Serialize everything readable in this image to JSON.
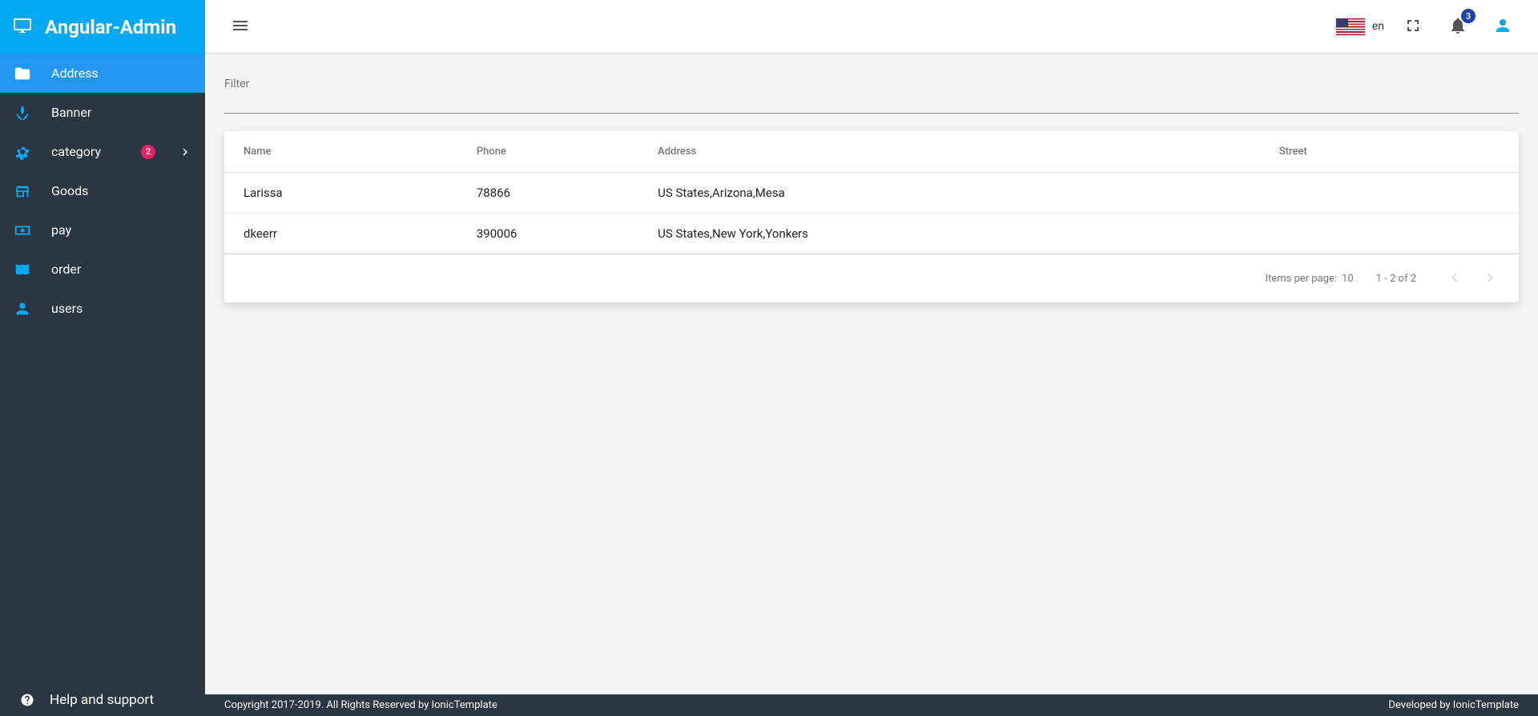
{
  "brand": {
    "title": "Angular-Admin"
  },
  "sidebar": {
    "items": [
      {
        "id": "address",
        "label": "Address",
        "icon": "folder",
        "active": true
      },
      {
        "id": "banner",
        "label": "Banner",
        "icon": "spa"
      },
      {
        "id": "category",
        "label": "category",
        "icon": "settings",
        "badge": "2",
        "expandable": true
      },
      {
        "id": "goods",
        "label": "Goods",
        "icon": "store"
      },
      {
        "id": "pay",
        "label": "pay",
        "icon": "money"
      },
      {
        "id": "order",
        "label": "order",
        "icon": "book"
      },
      {
        "id": "users",
        "label": "users",
        "icon": "person"
      }
    ],
    "footer": {
      "label": "Help and support"
    }
  },
  "topbar": {
    "language_code": "en",
    "notification_count": "3"
  },
  "filter": {
    "label": "Filter",
    "value": ""
  },
  "table": {
    "columns": [
      {
        "key": "name",
        "label": "Name"
      },
      {
        "key": "phone",
        "label": "Phone"
      },
      {
        "key": "address",
        "label": "Address"
      },
      {
        "key": "street",
        "label": "Street"
      }
    ],
    "rows": [
      {
        "name": "Larissa",
        "phone": "78866",
        "address": "US States,Arizona,Mesa",
        "street": ""
      },
      {
        "name": "dkeerr",
        "phone": "390006",
        "address": "US States,New York,Yonkers",
        "street": ""
      }
    ]
  },
  "pagination": {
    "items_per_page_label": "Items per page:",
    "items_per_page": "10",
    "range": "1 - 2 of 2"
  },
  "footer": {
    "copyright": "Copyright 2017-2019. All Rights Reserved by IonicTemplate",
    "developed": "Developed by IonicTemplate"
  }
}
